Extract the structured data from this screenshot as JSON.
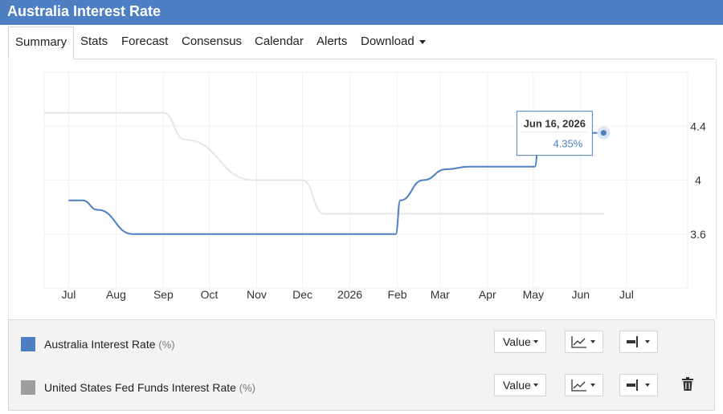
{
  "header": {
    "title": "Australia Interest Rate"
  },
  "tabs": [
    {
      "label": "Summary"
    },
    {
      "label": "Stats"
    },
    {
      "label": "Forecast"
    },
    {
      "label": "Consensus"
    },
    {
      "label": "Calendar"
    },
    {
      "label": "Alerts"
    },
    {
      "label": "Download"
    }
  ],
  "colors": {
    "header": "#4d7fc2",
    "series_au": "#4d7fc2",
    "series_us": "#e6e6e6"
  },
  "chart_data": {
    "type": "line",
    "title": "",
    "xlabel": "",
    "ylabel": "",
    "x_ticks": [
      "Jul",
      "Aug",
      "Sep",
      "Oct",
      "Nov",
      "Dec",
      "2026",
      "Feb",
      "Mar",
      "Apr",
      "May",
      "Jun",
      "Jul"
    ],
    "y_ticks": [
      "4.4",
      "4",
      "3.6"
    ],
    "ylim": [
      3.2,
      4.8
    ],
    "y_axis_side": "right",
    "grid": true,
    "series": [
      {
        "name": "Australia Interest Rate",
        "color": "#4d7fc2",
        "points": [
          {
            "x": "2025-07-01",
            "y": 3.85
          },
          {
            "x": "2025-07-10",
            "y": 3.85
          },
          {
            "x": "2025-07-20",
            "y": 3.78
          },
          {
            "x": "2025-08-12",
            "y": 3.6
          },
          {
            "x": "2026-01-31",
            "y": 3.6
          },
          {
            "x": "2026-02-03",
            "y": 3.85
          },
          {
            "x": "2026-02-18",
            "y": 4.0
          },
          {
            "x": "2026-03-05",
            "y": 4.08
          },
          {
            "x": "2026-03-20",
            "y": 4.1
          },
          {
            "x": "2026-05-02",
            "y": 4.1
          },
          {
            "x": "2026-05-05",
            "y": 4.35
          },
          {
            "x": "2026-06-16",
            "y": 4.35
          }
        ]
      },
      {
        "name": "United States Fed Funds Interest Rate",
        "color": "#e6e6e6",
        "points": [
          {
            "x": "2025-06-15",
            "y": 4.5
          },
          {
            "x": "2025-09-01",
            "y": 4.5
          },
          {
            "x": "2025-09-15",
            "y": 4.3
          },
          {
            "x": "2025-10-30",
            "y": 4.0
          },
          {
            "x": "2025-12-01",
            "y": 4.0
          },
          {
            "x": "2025-12-15",
            "y": 3.75
          },
          {
            "x": "2026-06-16",
            "y": 3.75
          }
        ]
      }
    ],
    "tooltip": {
      "date": "Jun 16, 2026",
      "value": "4.35%"
    }
  },
  "legend": {
    "rows": [
      {
        "name": "Australia Interest Rate",
        "unit": "(%)",
        "color": "#4d7fc2",
        "value_label": "Value"
      },
      {
        "name": "United States Fed Funds Interest Rate",
        "unit": "(%)",
        "color": "#9e9e9e",
        "value_label": "Value"
      }
    ]
  }
}
